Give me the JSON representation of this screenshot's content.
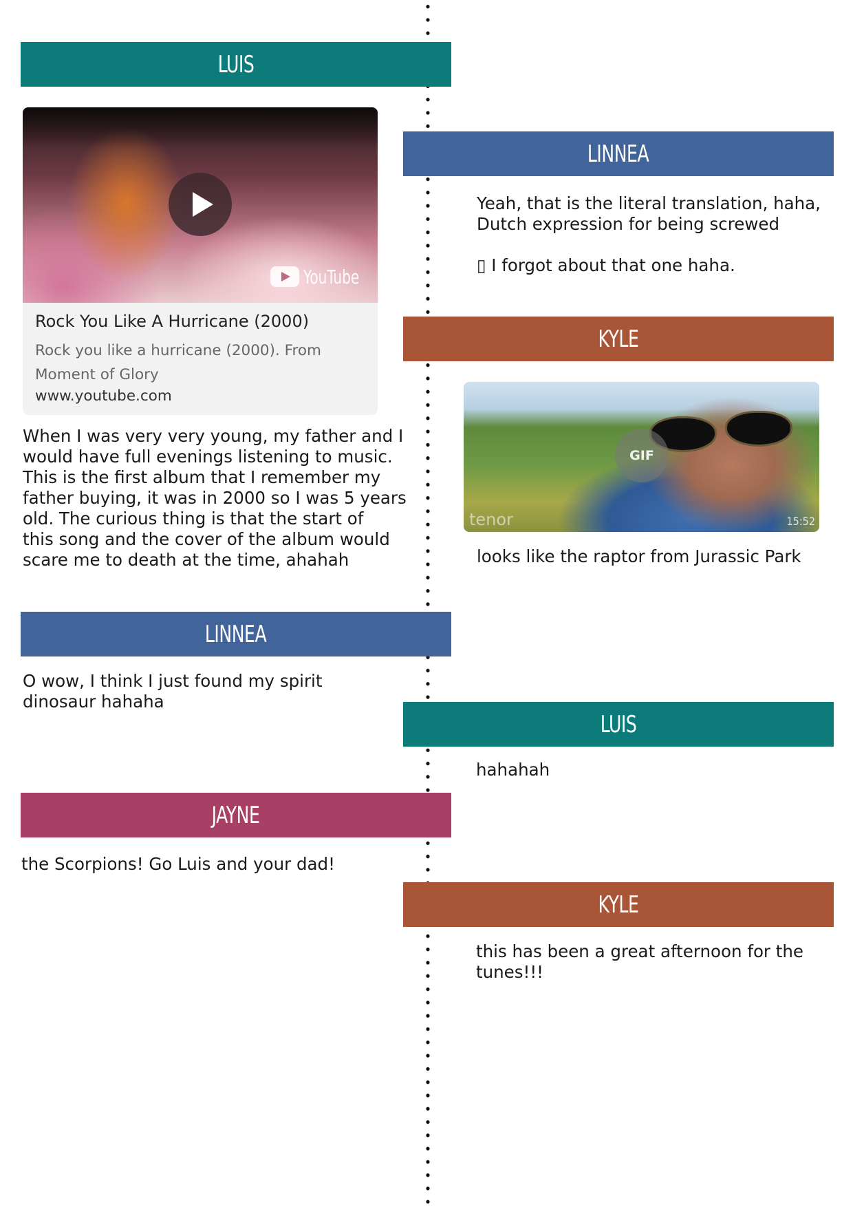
{
  "colors": {
    "luis": "#0e7b7b",
    "linnea": "#41649b",
    "kyle": "#a85637",
    "jayne": "#a83f65"
  },
  "posts": {
    "luis_1": {
      "name": "LUIS",
      "embed": {
        "title": "Rock You Like A Hurricane (2000)",
        "description": "Rock you like a hurricane (2000). From Moment of Glory",
        "url": "www.youtube.com",
        "logo": "YouTube",
        "icon": "play-icon"
      },
      "text": "When I was very very young, my father and I\nwould have full evenings listening to music.\nThis is the first album that I remember my\nfather buying, it was in 2000 so I was 5 years\nold. The curious thing is that the start of\nthis song and the cover of the album would\nscare me to death at the time, ahahah"
    },
    "linnea_1": {
      "name": "LINNEA",
      "text": "Yeah, that is the literal translation, haha,\nDutch expression for being screwed",
      "text2": "▯ I forgot about that one haha."
    },
    "kyle_1": {
      "name": "KYLE",
      "gif": {
        "badge": "GIF",
        "watermark": "tenor",
        "duration": "15:52"
      },
      "text": "looks like the raptor from Jurassic Park"
    },
    "linnea_2": {
      "name": "LINNEA",
      "text": "O wow, I think I just found my  spirit\ndinosaur hahaha"
    },
    "luis_2": {
      "name": "LUIS",
      "text": "hahahah"
    },
    "jayne_1": {
      "name": "JAYNE",
      "text": "the Scorpions! Go Luis and your dad!"
    },
    "kyle_2": {
      "name": "KYLE",
      "text": "this has been a great afternoon for the\ntunes!!!"
    }
  }
}
